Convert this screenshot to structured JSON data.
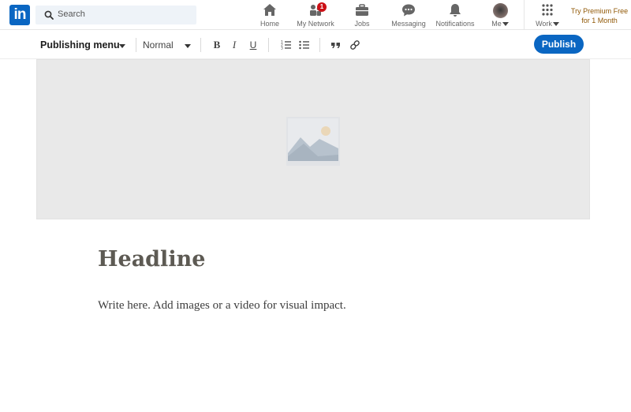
{
  "nav": {
    "logo_text": "in",
    "search_placeholder": "Search",
    "items": [
      {
        "label": "Home",
        "icon": "home-icon"
      },
      {
        "label": "My Network",
        "icon": "network-icon",
        "badge": "1"
      },
      {
        "label": "Jobs",
        "icon": "briefcase-icon"
      },
      {
        "label": "Messaging",
        "icon": "chat-icon"
      },
      {
        "label": "Notifications",
        "icon": "bell-icon"
      },
      {
        "label": "Me",
        "icon": "avatar"
      }
    ],
    "work_label": "Work",
    "premium_line1": "Try Premium Free",
    "premium_line2": "for 1 Month"
  },
  "toolbar": {
    "publishing_menu_label": "Publishing menu",
    "text_style_value": "Normal",
    "bold_label": "B",
    "italic_label": "I",
    "underline_label": "U",
    "publish_label": "Publish"
  },
  "editor": {
    "headline_placeholder": "Headline",
    "body_placeholder": "Write here. Add images or a video for visual impact."
  },
  "colors": {
    "brand_blue": "#0a66c2",
    "premium_text": "#915907",
    "badge_red": "#cc1016",
    "cover_bg": "#e9e9e9"
  }
}
